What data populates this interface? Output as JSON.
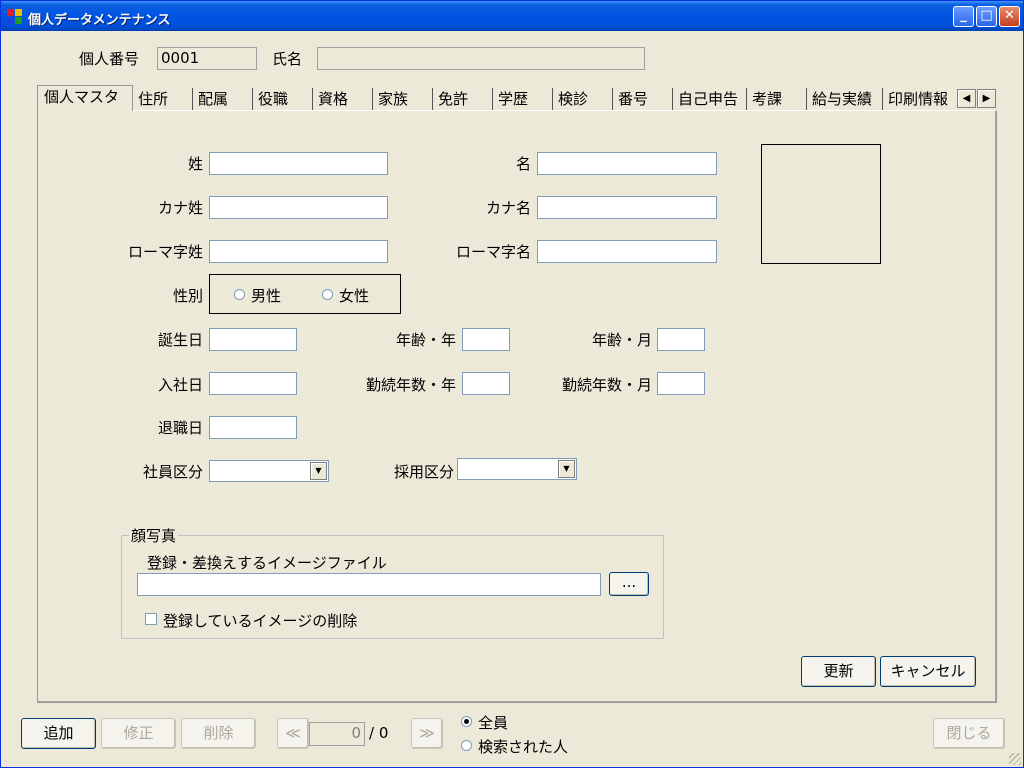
{
  "window": {
    "title": "個人データメンテナンス",
    "minimize": "_",
    "maximize": "□",
    "close": "✕"
  },
  "header": {
    "id_label": "個人番号",
    "id_value": "0001",
    "name_label": "氏名",
    "name_value": ""
  },
  "tabs": [
    "個人マスタ",
    "住所",
    "配属",
    "役職",
    "資格",
    "家族",
    "免許",
    "学歴",
    "検診",
    "番号",
    "自己申告",
    "考課",
    "給与実績",
    "印刷情報"
  ],
  "tab_scroll": {
    "left": "◀",
    "right": "▶"
  },
  "form": {
    "last_name": "姓",
    "first_name": "名",
    "kana_last": "カナ姓",
    "kana_first": "カナ名",
    "roma_last": "ローマ字姓",
    "roma_first": "ローマ字名",
    "gender": "性別",
    "male": "男性",
    "female": "女性",
    "birthday": "誕生日",
    "age_year": "年齢・年",
    "age_month": "年齢・月",
    "join_date": "入社日",
    "service_year": "勤続年数・年",
    "service_month": "勤続年数・月",
    "retire_date": "退職日",
    "employee_type": "社員区分",
    "hire_type": "採用区分"
  },
  "photo_group": {
    "title": "顔写真",
    "file_label": "登録・差換えするイメージファイル",
    "browse": "...",
    "delete_label": "登録しているイメージの削除"
  },
  "actions": {
    "update": "更新",
    "cancel": "キャンセル"
  },
  "footer": {
    "add": "追加",
    "edit": "修正",
    "delete": "削除",
    "prev": "≪",
    "next": "≫",
    "record_value": "0",
    "record_total": "/ 0",
    "all": "全員",
    "searched": "検索された人",
    "close": "閉じる"
  }
}
